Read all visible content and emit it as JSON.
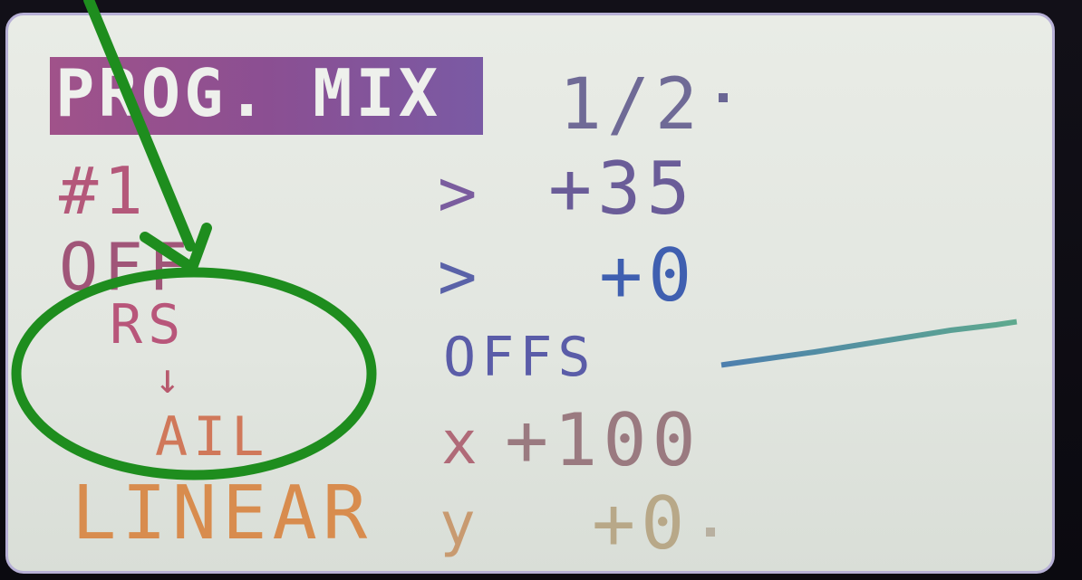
{
  "screen": {
    "title": "PROG. MIX",
    "page": "1/2",
    "mix_number": "#1",
    "mode": "OFF",
    "master": "RS",
    "direction_arrow": "↓",
    "slave": "AIL",
    "curve": "LINEAR",
    "rate1_arrow": ">",
    "rate1": "+35",
    "rate2_arrow": ">",
    "rate2": "+0",
    "offset_label": "OFFS",
    "x_label": "x",
    "x_value": "+100",
    "y_label": "y",
    "y_value": "+0"
  },
  "colors": {
    "annotation": "#1f8f1f",
    "title_bg": "#8b4f92",
    "screen_bg": "#e6e9e3"
  },
  "icons": {
    "annotation_arrow": "arrow-pointer-icon",
    "annotation_ellipse": "highlight-ellipse"
  }
}
